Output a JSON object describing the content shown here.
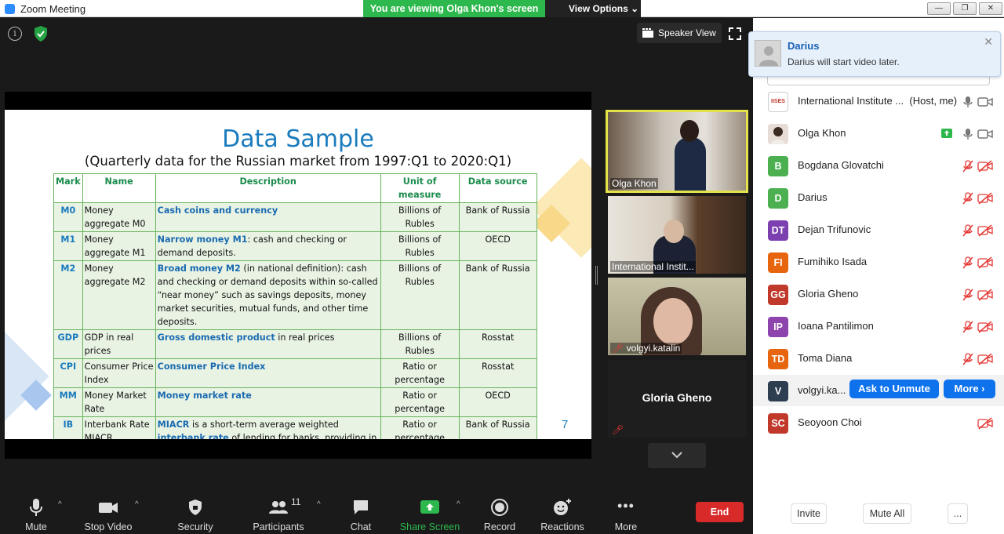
{
  "window": {
    "title": "Zoom Meeting",
    "min": "—",
    "max": "❐",
    "close": "✕"
  },
  "banner": {
    "viewing": "You are viewing Olga Khon's screen",
    "view_options": "View Options"
  },
  "top": {
    "speaker_view": "Speaker View"
  },
  "slide": {
    "title": "Data Sample",
    "subtitle": "(Quarterly data for the Russian market from 1997:Q1 to 2020:Q1)",
    "page_number": "7",
    "headers": [
      "Mark",
      "Name",
      "Description",
      "Unit of measure",
      "Data source"
    ],
    "rows": [
      {
        "mark": "M0",
        "name": "Money aggregate M0",
        "desc_hl": "Cash coins and currency",
        "desc_rest": "",
        "unit": "Billions of Rubles",
        "source": "Bank of Russia"
      },
      {
        "mark": "M1",
        "name": "Money aggregate M1",
        "desc_hl": "Narrow money M1",
        "desc_rest": ": cash and checking or demand deposits.",
        "unit": "Billions of Rubles",
        "source": "OECD"
      },
      {
        "mark": "M2",
        "name": "Money aggregate M2",
        "desc_hl": "Broad money M2",
        "desc_rest": " (in national definition): cash and checking or demand deposits within so-called “near money” such as savings deposits, money market securities, mutual funds, and other time deposits.",
        "unit": "Billions of Rubles",
        "source": "Bank of Russia"
      },
      {
        "mark": "GDP",
        "name": "GDP in real prices",
        "desc_hl": "Gross domestic product",
        "desc_rest": " in real prices",
        "unit": "Billions of Rubles",
        "source": "Rosstat"
      },
      {
        "mark": "CPI",
        "name": "Consumer Price Index",
        "desc_hl": "Consumer Price Index",
        "desc_rest": "",
        "unit": "Ratio or percentage",
        "source": "Rosstat"
      },
      {
        "mark": "MM",
        "name": "Money Market Rate",
        "desc_hl": "Money market rate",
        "desc_rest": "",
        "unit": "Ratio or percentage",
        "source": "OECD"
      },
      {
        "mark": "IB",
        "name": "Interbank Rate MIACR",
        "desc_hl": "MIACR",
        "desc_mid": " is a short-term average weighted ",
        "desc_hl2": "interbank rate",
        "desc_rest": " of lending for banks, providing in rubles by the largest Russian bank from Moscow region.",
        "unit": "Ratio or percentage",
        "source": "Bank of Russia"
      }
    ]
  },
  "videos": [
    {
      "name": "Olga Khon"
    },
    {
      "name": "International Instit..."
    },
    {
      "name": "volgyi.katalin"
    },
    {
      "name": "Gloria Gheno"
    }
  ],
  "toolbar": {
    "mute": "Mute",
    "stop_video": "Stop Video",
    "security": "Security",
    "participants": "Participants",
    "participants_count": "11",
    "chat": "Chat",
    "share_screen": "Share Screen",
    "record": "Record",
    "reactions": "Reactions",
    "more": "More",
    "end": "End"
  },
  "toast": {
    "name": "Darius",
    "message": "Darius will start video later."
  },
  "participants": [
    {
      "initials": "IISES",
      "name": "International Institute ...",
      "role": "(Host, me)",
      "color": "#ffffff"
    },
    {
      "initials": "",
      "name": "Olga Khon",
      "color": "#e8dcd6"
    },
    {
      "initials": "B",
      "name": "Bogdana Glovatchi",
      "color": "#4caf50"
    },
    {
      "initials": "D",
      "name": "Darius",
      "color": "#4caf50"
    },
    {
      "initials": "DT",
      "name": "Dejan Trifunovic",
      "color": "#7b3fb0"
    },
    {
      "initials": "FI",
      "name": "Fumihiko Isada",
      "color": "#e8650f"
    },
    {
      "initials": "GG",
      "name": "Gloria Gheno",
      "color": "#c0392b"
    },
    {
      "initials": "IP",
      "name": "Ioana Pantilimon",
      "color": "#8e44ad"
    },
    {
      "initials": "TD",
      "name": "Toma Diana",
      "color": "#e8650f"
    },
    {
      "initials": "V",
      "name": "volgyi.ka...",
      "color": "#2c3e50"
    },
    {
      "initials": "SC",
      "name": "Seoyoon Choi",
      "color": "#c0392b"
    }
  ],
  "panel": {
    "ask_unmute": "Ask to Unmute",
    "more": "More ›",
    "invite": "Invite",
    "mute_all": "Mute All",
    "dots": "..."
  }
}
